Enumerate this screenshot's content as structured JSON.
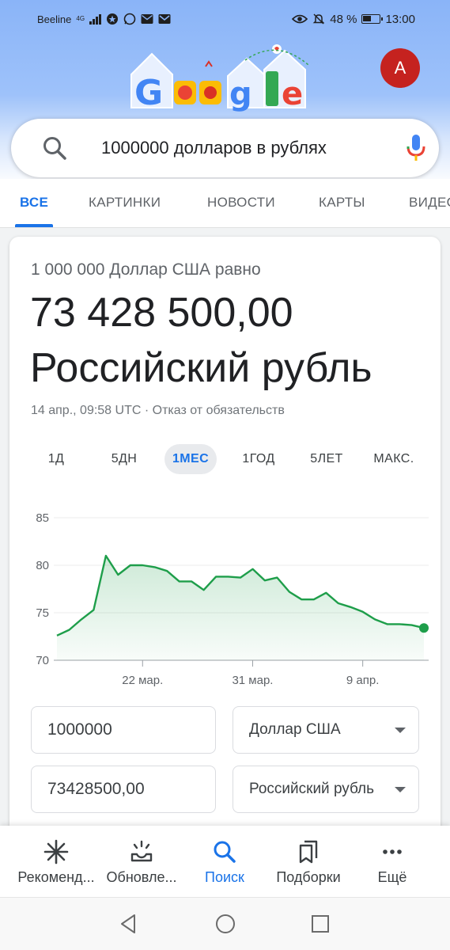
{
  "status_bar": {
    "carrier": "Beeline",
    "network": "4G",
    "battery": "48 %",
    "time": "13:00"
  },
  "account": {
    "avatar_letter": "A"
  },
  "search": {
    "query": "1000000 долларов в рублях"
  },
  "tabs": [
    {
      "label": "ВСЕ",
      "active": true
    },
    {
      "label": "КАРТИНКИ",
      "active": false
    },
    {
      "label": "НОВОСТИ",
      "active": false
    },
    {
      "label": "КАРТЫ",
      "active": false
    },
    {
      "label": "ВИДЕО",
      "active": false
    }
  ],
  "converter": {
    "equal_line": "1 000 000 Доллар США равно",
    "result_amount": "73 428 500,00",
    "result_currency": "Российский рубль",
    "timestamp": "14 апр., 09:58 UTC · Отказ от обязательств",
    "ranges": [
      "1Д",
      "5ДН",
      "1МЕС",
      "1ГОД",
      "5ЛЕТ",
      "МАКС."
    ],
    "active_range": "1МЕС",
    "from_amount": "1000000",
    "from_currency": "Доллар США",
    "to_amount": "73428500,00",
    "to_currency": "Российский рубль"
  },
  "chart_data": {
    "type": "area",
    "title": "",
    "xlabel": "",
    "ylabel": "",
    "ylim": [
      70,
      85
    ],
    "yticks": [
      70,
      75,
      80,
      85
    ],
    "xtick_labels": [
      "22 мар.",
      "31 мар.",
      "9 апр."
    ],
    "grid": true,
    "color": "#1e9e4a",
    "x": [
      "15 мар.",
      "16 мар.",
      "17 мар.",
      "18 мар.",
      "19 мар.",
      "20 мар.",
      "21 мар.",
      "22 мар.",
      "23 мар.",
      "24 мар.",
      "25 мар.",
      "26 мар.",
      "27 мар.",
      "28 мар.",
      "29 мар.",
      "30 мар.",
      "31 мар.",
      "1 апр.",
      "2 апр.",
      "3 апр.",
      "4 апр.",
      "5 апр.",
      "6 апр.",
      "7 апр.",
      "8 апр.",
      "9 апр.",
      "10 апр.",
      "11 апр.",
      "12 апр.",
      "13 апр.",
      "14 апр."
    ],
    "values": [
      72.6,
      73.2,
      74.3,
      75.3,
      81.0,
      79.0,
      80.0,
      80.0,
      79.8,
      79.4,
      78.3,
      78.3,
      77.4,
      78.8,
      78.8,
      78.7,
      79.6,
      78.4,
      78.7,
      77.2,
      76.4,
      76.4,
      77.1,
      76.0,
      75.6,
      75.1,
      74.3,
      73.8,
      73.8,
      73.7,
      73.4
    ]
  },
  "bottom_nav": [
    {
      "label": "Рекоменд...",
      "icon": "sparkle-icon",
      "active": false
    },
    {
      "label": "Обновле...",
      "icon": "updates-icon",
      "active": false
    },
    {
      "label": "Поиск",
      "icon": "search-icon",
      "active": true
    },
    {
      "label": "Подборки",
      "icon": "collections-icon",
      "active": false
    },
    {
      "label": "Ещё",
      "icon": "more-icon",
      "active": false
    }
  ],
  "colors": {
    "accent": "#1a73e8",
    "chart_line": "#1e9e4a",
    "avatar": "#c5221f"
  }
}
